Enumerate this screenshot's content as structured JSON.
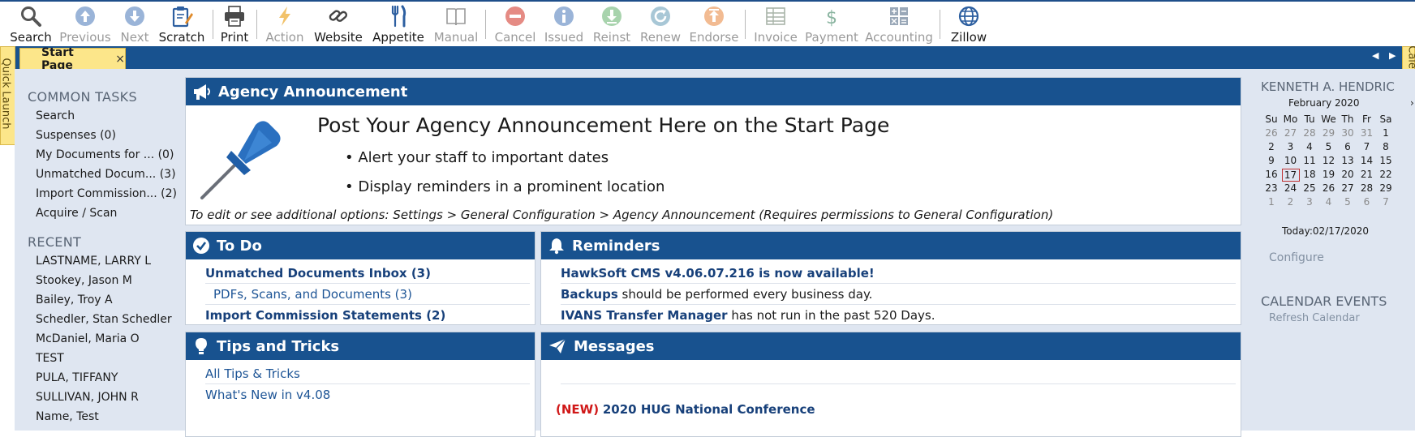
{
  "toolbar": {
    "buttons": [
      {
        "label": "Search",
        "icon": "search-icon",
        "enabled": true
      },
      {
        "label": "Previous",
        "icon": "up-arrow-icon",
        "enabled": false
      },
      {
        "label": "Next",
        "icon": "down-arrow-icon",
        "enabled": false
      },
      {
        "label": "Scratch",
        "icon": "clipboard-pencil-icon",
        "enabled": true
      },
      {
        "label": "Print",
        "icon": "printer-icon",
        "enabled": true
      },
      {
        "label": "Action",
        "icon": "lightning-icon",
        "enabled": false
      },
      {
        "label": "Website",
        "icon": "link-icon",
        "enabled": true
      },
      {
        "label": "Appetite",
        "icon": "fork-knife-icon",
        "enabled": true
      },
      {
        "label": "Manual",
        "icon": "book-icon",
        "enabled": false
      },
      {
        "label": "Cancel",
        "icon": "minus-circle-icon",
        "enabled": false
      },
      {
        "label": "Issued",
        "icon": "info-circle-icon",
        "enabled": false
      },
      {
        "label": "Reinst",
        "icon": "download-circle-icon",
        "enabled": false
      },
      {
        "label": "Renew",
        "icon": "refresh-circle-icon",
        "enabled": false
      },
      {
        "label": "Endorse",
        "icon": "upload-circle-icon",
        "enabled": false
      },
      {
        "label": "Invoice",
        "icon": "invoice-icon",
        "enabled": false
      },
      {
        "label": "Payment",
        "icon": "dollar-icon",
        "enabled": false
      },
      {
        "label": "Accounting",
        "icon": "calculator-icon",
        "enabled": false
      },
      {
        "label": "Zillow",
        "icon": "globe-icon",
        "enabled": true
      }
    ]
  },
  "tabs": {
    "active_label": "Start Page",
    "close_glyph": "×",
    "quick_launch": "Quick Launch",
    "calendar": "Calendar"
  },
  "left": {
    "common_heading": "COMMON TASKS",
    "common_items": [
      "Search",
      "Suspenses (0)",
      "My Documents for ... (0)",
      "Unmatched Docum... (3)",
      "Import Commission... (2)",
      "Acquire / Scan"
    ],
    "recent_heading": "RECENT",
    "recent_items": [
      "LASTNAME, LARRY L",
      "Stookey, Jason M",
      "Bailey, Troy A",
      "Schedler, Stan Schedler",
      "McDaniel, Maria O",
      "TEST",
      "PULA, TIFFANY",
      "SULLIVAN, JOHN R",
      "Name, Test"
    ]
  },
  "announcement": {
    "title": "Agency Announcement",
    "headline": "Post Your Agency Announcement Here on the Start Page",
    "bullets": [
      "Alert your staff to important dates",
      "Display reminders in a prominent location"
    ],
    "note": "To edit or see additional options: Settings > General Configuration > Agency Announcement  (Requires permissions to General Configuration)"
  },
  "todo": {
    "title": "To Do",
    "rows": [
      {
        "text": "Unmatched Documents Inbox (3)",
        "style": "bold"
      },
      {
        "text": "PDFs, Scans, and Documents (3)",
        "style": "sub"
      },
      {
        "text": "Import Commission Statements (2)",
        "style": "bold"
      }
    ]
  },
  "reminders": {
    "title": "Reminders",
    "rows": [
      {
        "bold": "HawkSoft CMS v4.06.07.216 is now available!",
        "rest": ""
      },
      {
        "bold": "Backups",
        "rest": " should be performed every business day."
      },
      {
        "bold": "IVANS Transfer Manager",
        "rest": " has not run in the past 520 Days."
      }
    ]
  },
  "tips": {
    "title": "Tips and Tricks",
    "rows": [
      "All Tips & Tricks",
      "What's New in v4.08"
    ]
  },
  "messages": {
    "title": "Messages",
    "new_tag": "(NEW)",
    "item": "2020 HUG National Conference"
  },
  "calendar": {
    "user": "KENNETH A. HENDRIC",
    "month": "February 2020",
    "nav_glyph": "›",
    "weekdays": [
      "Su",
      "Mo",
      "Tu",
      "We",
      "Th",
      "Fr",
      "Sa"
    ],
    "weeks": [
      [
        "26",
        "27",
        "28",
        "29",
        "30",
        "31",
        "1"
      ],
      [
        "2",
        "3",
        "4",
        "5",
        "6",
        "7",
        "8"
      ],
      [
        "9",
        "10",
        "11",
        "12",
        "13",
        "14",
        "15"
      ],
      [
        "16",
        "17",
        "18",
        "19",
        "20",
        "21",
        "22"
      ],
      [
        "23",
        "24",
        "25",
        "26",
        "27",
        "28",
        "29"
      ],
      [
        "1",
        "2",
        "3",
        "4",
        "5",
        "6",
        "7"
      ]
    ],
    "today_label": "Today:02/17/2020",
    "configure": "Configure",
    "events_heading": "CALENDAR EVENTS",
    "refresh": "Refresh Calendar"
  }
}
